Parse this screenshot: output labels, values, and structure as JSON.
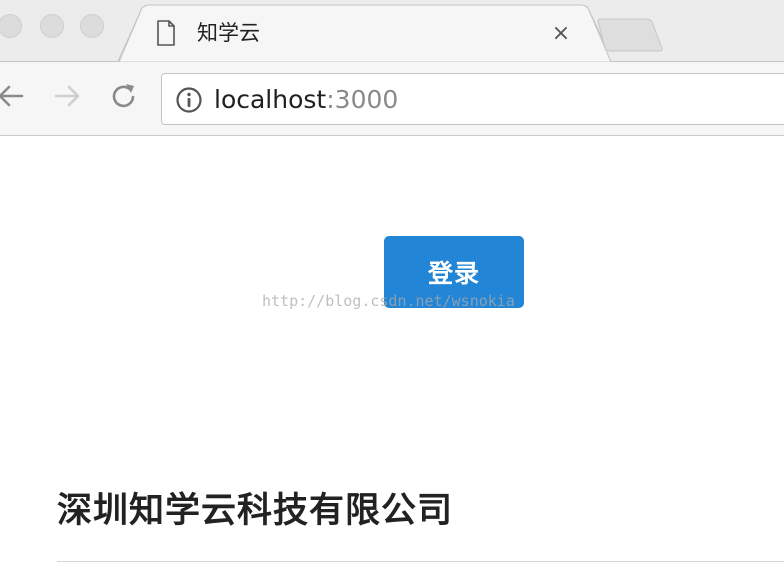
{
  "tab": {
    "title": "知学云",
    "close_glyph": "×"
  },
  "address_bar": {
    "host": "localhost",
    "port": ":3000"
  },
  "page": {
    "login_label": "登录",
    "watermark": "http://blog.csdn.net/wsnokia",
    "company_name": "深圳知学云科技有限公司"
  },
  "colors": {
    "accent": "#2385d5",
    "tabstrip": "#ececec",
    "toolbar": "#f6f6f6"
  }
}
